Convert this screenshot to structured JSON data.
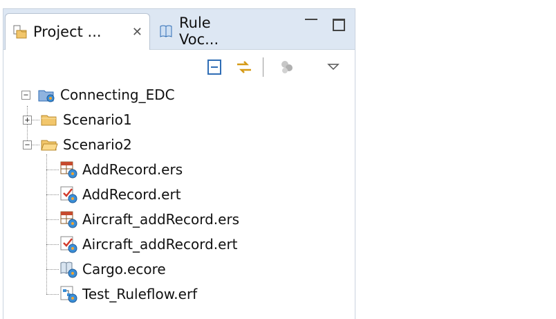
{
  "tabs": [
    {
      "label": "Project ...",
      "icon": "project-explorer-icon",
      "close": "✕"
    },
    {
      "label": "Rule Voc...",
      "icon": "book-icon"
    }
  ],
  "toolbar": {
    "items": [
      "collapse-all-icon",
      "link-with-editor-icon",
      "filter-icon",
      "view-menu-icon"
    ]
  },
  "tree": {
    "root": {
      "label": "Connecting_EDC",
      "icon": "project-folder-icon",
      "expanded": true
    },
    "folders": [
      {
        "label": "Scenario1",
        "expanded": false
      },
      {
        "label": "Scenario2",
        "expanded": true
      }
    ],
    "files": [
      {
        "label": "AddRecord.ers",
        "icon": "rule-set-icon"
      },
      {
        "label": "AddRecord.ert",
        "icon": "rule-test-icon"
      },
      {
        "label": "Aircraft_addRecord.ers",
        "icon": "rule-set-icon"
      },
      {
        "label": "Aircraft_addRecord.ert",
        "icon": "rule-test-icon"
      },
      {
        "label": "Cargo.ecore",
        "icon": "vocabulary-icon"
      },
      {
        "label": "Test_Ruleflow.erf",
        "icon": "ruleflow-icon"
      }
    ]
  },
  "colors": {
    "tabbar": "#dde7f3",
    "folder": "#f2c66b",
    "accent": "#2f6db5"
  }
}
